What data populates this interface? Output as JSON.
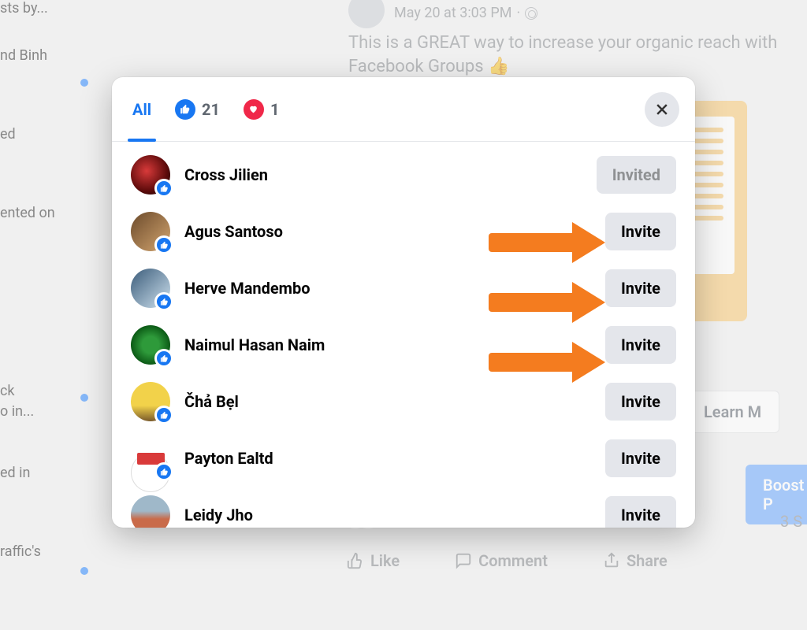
{
  "background": {
    "post_timestamp": "May 20 at 3:03 PM",
    "post_text": "This is a GREAT way to increase your organic reach with Facebook Groups 👍",
    "learn_more": "Learn M",
    "boost": "Boost P",
    "like": "Like",
    "comment": "Comment",
    "share": "Share",
    "stat_right": "3 S",
    "left_fragments": [
      "sts by...",
      "nd Binh",
      "ed",
      "ented on",
      "ck",
      "o in...",
      "ed in",
      "raffic's"
    ]
  },
  "modal": {
    "tabs": {
      "all": "All",
      "like_count": "21",
      "love_count": "1"
    },
    "invite_label": "Invite",
    "invited_label": "Invited",
    "people": [
      {
        "name": "Cross Jilien",
        "status": "invited"
      },
      {
        "name": "Agus Santoso",
        "status": "invite"
      },
      {
        "name": "Herve Mandembo",
        "status": "invite"
      },
      {
        "name": "Naimul Hasan Naim",
        "status": "invite"
      },
      {
        "name": "Čhả Bẹl",
        "status": "invite"
      },
      {
        "name": "Payton Ealtd",
        "status": "invite"
      },
      {
        "name": "Leidy Jho",
        "status": "invite"
      }
    ]
  }
}
